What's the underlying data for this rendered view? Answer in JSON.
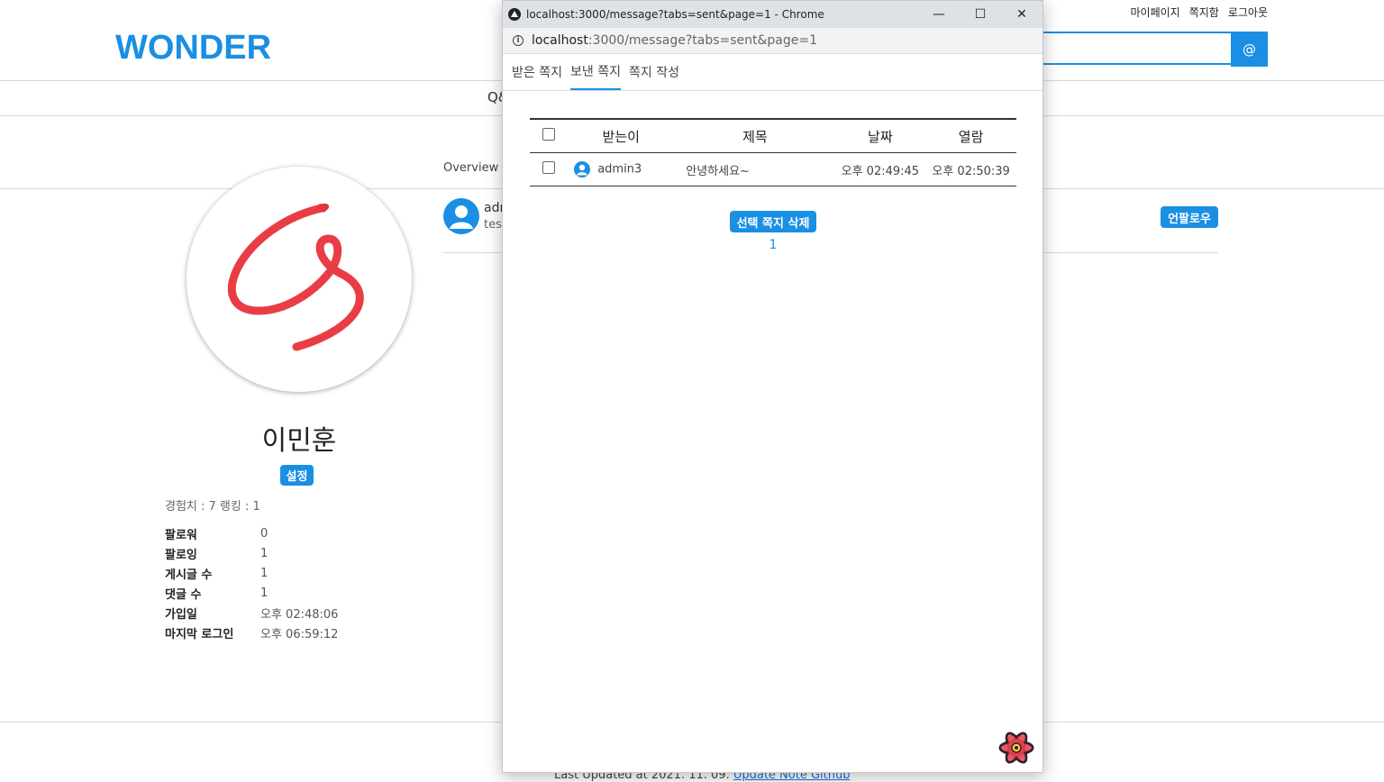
{
  "site": {
    "logo": "WONDER",
    "top_links": [
      "마이페이지",
      "쪽지함",
      "로그아웃"
    ],
    "search_button": "@",
    "nav_partial": "Q&",
    "overview_tab": "Overview"
  },
  "profile": {
    "name": "이민훈",
    "settings_label": "설정",
    "exp_text": "경험치 : 7 랭킹 : 1",
    "stats": [
      {
        "label": "팔로워",
        "value": "0"
      },
      {
        "label": "팔로잉",
        "value": "1"
      },
      {
        "label": "게시글 수",
        "value": "1"
      },
      {
        "label": "댓글 수",
        "value": "1"
      },
      {
        "label": "가입일",
        "value": "오후 02:48:06"
      },
      {
        "label": "마지막 로그인",
        "value": "오후 06:59:12"
      }
    ]
  },
  "following": {
    "name_partial": "adn",
    "sub_partial": "tes",
    "unfollow_label": "언팔로우"
  },
  "footer": {
    "text": "Last Updated at 2021. 11. 09.",
    "link": "Update Note Github"
  },
  "popup": {
    "window_title": "localhost:3000/message?tabs=sent&page=1 - Chrome",
    "url_host": "localhost",
    "url_path": ":3000/message?tabs=sent&page=1",
    "controls": [
      "—",
      "☐",
      "✕"
    ],
    "tabs": [
      {
        "label": "받은 쪽지",
        "active": false
      },
      {
        "label": "보낸 쪽지",
        "active": true
      },
      {
        "label": "쪽지 작성",
        "active": false
      }
    ],
    "table": {
      "headers": [
        "받는이",
        "제목",
        "날짜",
        "열람"
      ],
      "rows": [
        {
          "recipient": "admin3",
          "subject": "안녕하세요~",
          "date": "오후 02:49:45",
          "read": "오후 02:50:39"
        }
      ]
    },
    "delete_label": "선택 쪽지 삭제",
    "page": "1"
  },
  "colors": {
    "accent": "#1a8fe3",
    "signature": "#e8333b"
  }
}
